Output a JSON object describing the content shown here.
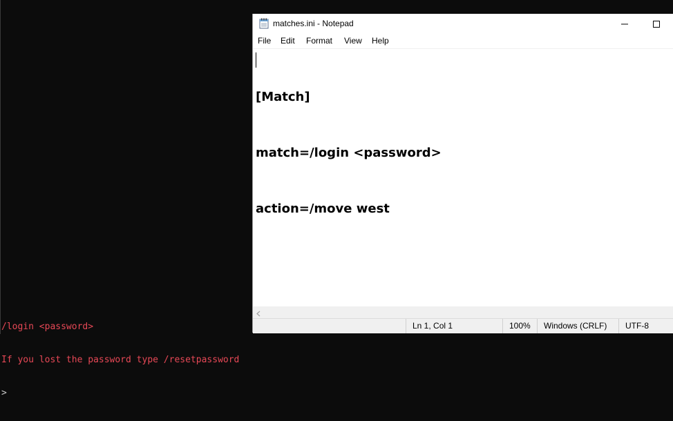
{
  "console": {
    "lines": [
      "/login <password>",
      "If you lost the password type /resetpassword"
    ],
    "prompt": ">",
    "text_color": "#e74856",
    "background": "#0c0c0c"
  },
  "notepad": {
    "title": "matches.ini - Notepad",
    "icon": "notepad-icon",
    "controls": {
      "minimize_icon": "minimize-icon",
      "maximize_icon": "maximize-icon"
    },
    "menu": [
      "File",
      "Edit",
      "Format",
      "View",
      "Help"
    ],
    "content": [
      "[Match]",
      "match=/login <password>",
      "action=/move west"
    ],
    "status": {
      "position": "Ln 1, Col 1",
      "zoom": "100%",
      "line_endings": "Windows (CRLF)",
      "encoding": "UTF-8"
    }
  }
}
